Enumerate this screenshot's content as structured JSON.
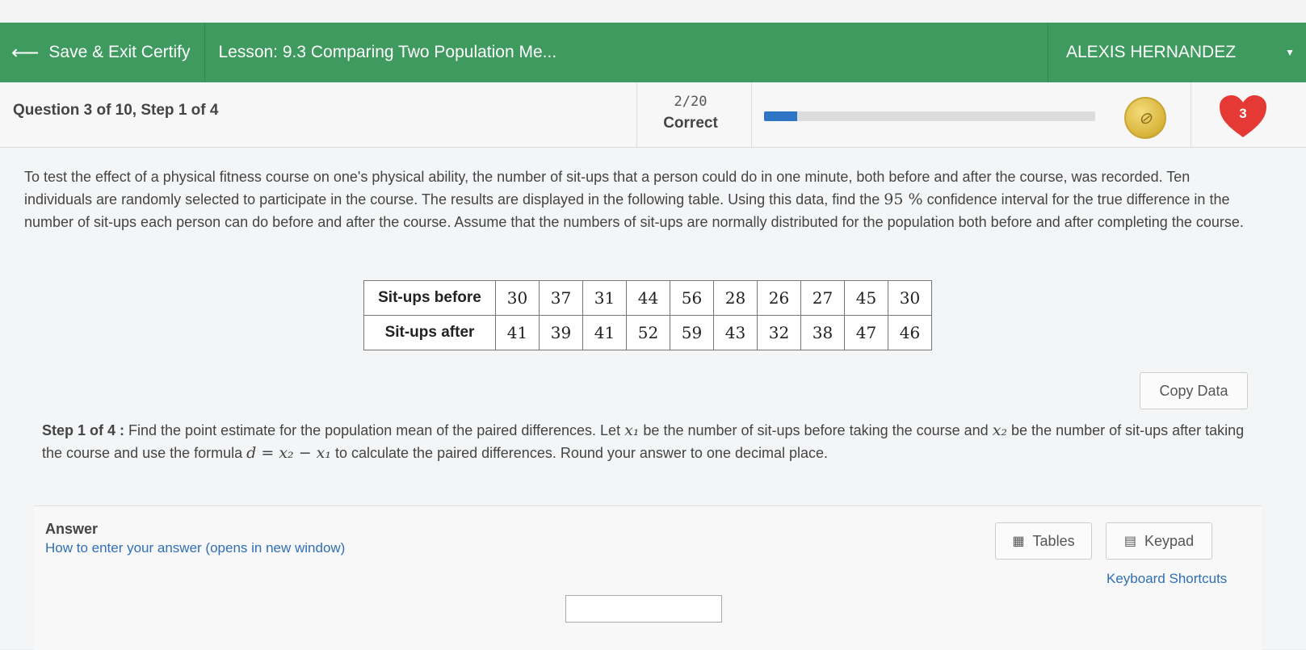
{
  "header": {
    "save_label": "Save & Exit Certify",
    "lesson_title": "Lesson: 9.3 Comparing Two Population Me...",
    "user_name": "ALEXIS HERNANDEZ"
  },
  "status": {
    "question_label": "Question 3 of 10, Step 1 of 4",
    "score_fraction": "2/20",
    "score_label": "Correct",
    "progress_fraction": 0.1,
    "hearts_count": "3"
  },
  "question": {
    "text_before": "To test the effect of a physical fitness course on one's physical ability, the number of sit-ups that a person could do in one minute, both before and after the course, was recorded. Ten individuals are randomly selected to participate in the course. The results are displayed in the following table. Using this data, find the ",
    "confidence": "95 %",
    "text_after": " confidence interval for the true difference in the number of sit-ups each person can do before and after the course. Assume that the numbers of sit-ups are normally distributed for the population both before and after completing the course."
  },
  "table": {
    "rows": [
      {
        "label": "Sit-ups before",
        "values": [
          "30",
          "37",
          "31",
          "44",
          "56",
          "28",
          "26",
          "27",
          "45",
          "30"
        ]
      },
      {
        "label": "Sit-ups after",
        "values": [
          "41",
          "39",
          "41",
          "52",
          "59",
          "43",
          "32",
          "38",
          "47",
          "46"
        ]
      }
    ]
  },
  "copy_data_label": "Copy Data",
  "step": {
    "label": "Step 1 of 4 :",
    "text1": " Find the point estimate for the population mean of the paired differences. Let ",
    "x1": "x₁",
    "text2": " be the number of sit-ups before taking the course and ",
    "x2": "x₂",
    "text3": " be the number of sit-ups after taking the course and use the formula ",
    "formula": "d = x₂ − x₁",
    "text4": " to calculate the paired differences. Round your answer to one decimal place."
  },
  "answer": {
    "title": "Answer",
    "help_link": "How to enter your answer (opens in new window)",
    "tables_label": "Tables",
    "keypad_label": "Keypad",
    "shortcuts_label": "Keyboard Shortcuts",
    "value": ""
  }
}
